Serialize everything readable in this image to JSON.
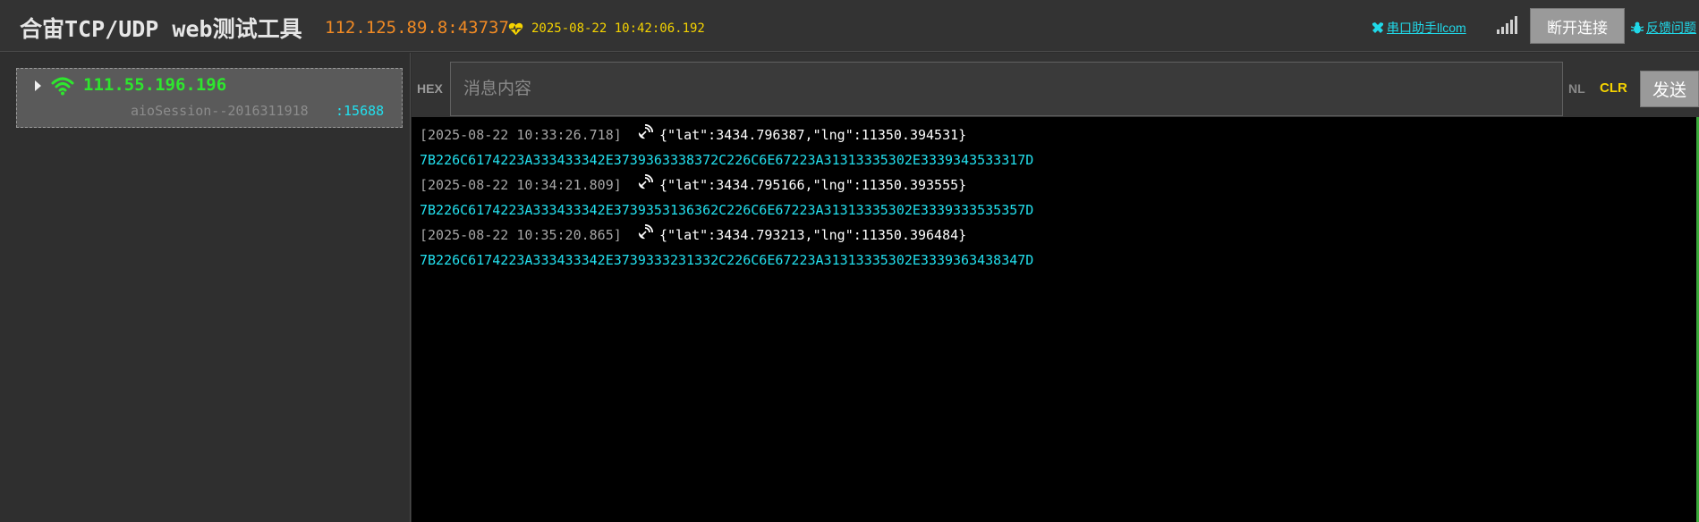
{
  "header": {
    "title": "合宙TCP/UDP web测试工具",
    "server_addr": "112.125.89.8:43737",
    "server_time": "2025-08-22 10:42:06.192",
    "serial_link": "串口助手llcom",
    "disconnect_label": "断开连接",
    "feedback_link": "反馈问题"
  },
  "sidebar": {
    "session": {
      "ip": "111.55.196.196",
      "id": "aioSession--2016311918",
      "port": ":15688"
    }
  },
  "toolbar": {
    "hex_label": "HEX",
    "input_placeholder": "消息内容",
    "input_value": "",
    "nl_label": "NL",
    "clr_label": "CLR",
    "send_label": "发送"
  },
  "log": [
    {
      "timestamp": "[2025-08-22 10:33:26.718]",
      "message": "{\"lat\":3434.796387,\"lng\":11350.394531}",
      "hex": "7B226C6174223A333433342E3739363338372C226C6E67223A31313335302E3339343533317D"
    },
    {
      "timestamp": "[2025-08-22 10:34:21.809]",
      "message": "{\"lat\":3434.795166,\"lng\":11350.393555}",
      "hex": "7B226C6174223A333433342E3739353136362C226C6E67223A31313335302E3339333535357D"
    },
    {
      "timestamp": "[2025-08-22 10:35:20.865]",
      "message": "{\"lat\":3434.793213,\"lng\":11350.396484}",
      "hex": "7B226C6174223A333433342E3739333231332C226C6E67223A31313335302E3339363438347D"
    }
  ],
  "colors": {
    "accent_cyan": "#22e0ee",
    "accent_orange": "#f08a24",
    "accent_yellow": "#f5d300",
    "accent_green": "#2ee62e"
  }
}
